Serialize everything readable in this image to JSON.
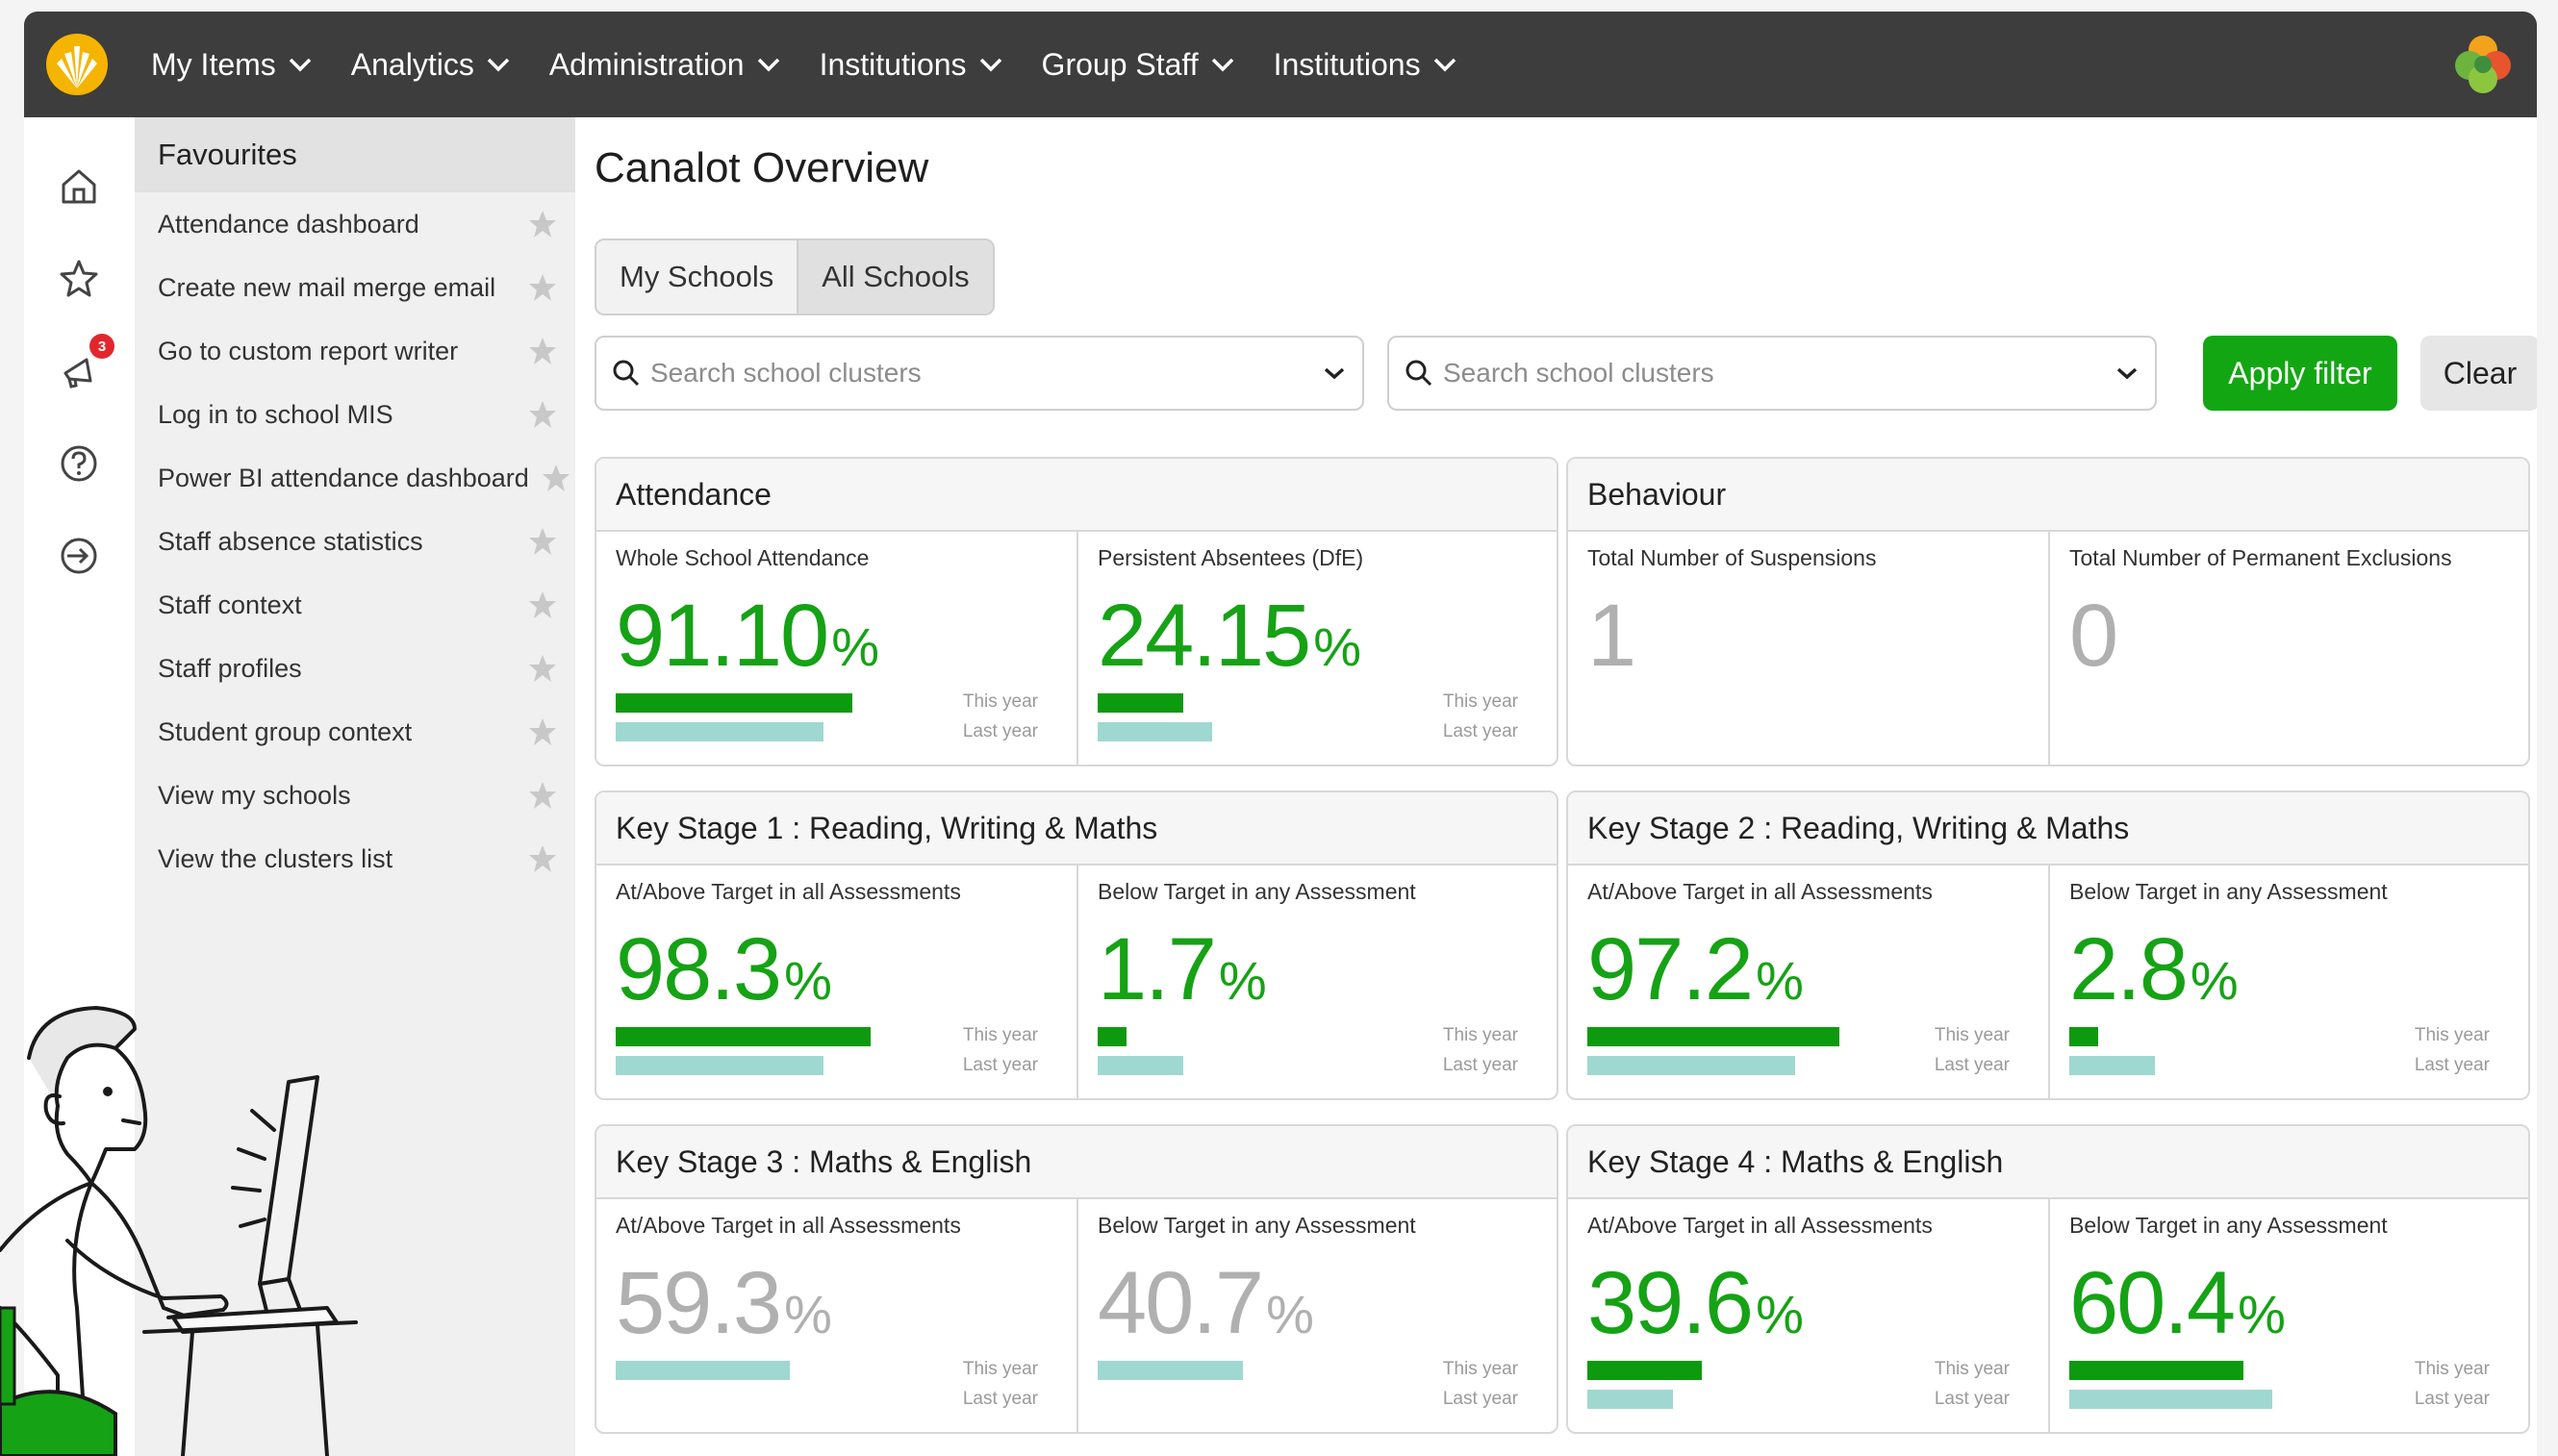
{
  "nav": {
    "items": [
      {
        "label": "My Items"
      },
      {
        "label": "Analytics"
      },
      {
        "label": "Administration"
      },
      {
        "label": "Institutions"
      },
      {
        "label": "Group Staff"
      },
      {
        "label": "Institutions"
      }
    ]
  },
  "rail": {
    "notification_count": "3"
  },
  "favourites": {
    "title": "Favourites",
    "items": [
      {
        "label": "Attendance dashboard"
      },
      {
        "label": "Create new mail merge email"
      },
      {
        "label": "Go to custom report writer"
      },
      {
        "label": "Log in to school MIS"
      },
      {
        "label": "Power BI attendance dashboard"
      },
      {
        "label": "Staff absence statistics"
      },
      {
        "label": "Staff context"
      },
      {
        "label": "Staff profiles"
      },
      {
        "label": "Student group context"
      },
      {
        "label": "View my schools"
      },
      {
        "label": "View the clusters list"
      }
    ]
  },
  "main": {
    "title": "Canalot Overview",
    "toggle": {
      "my_schools": "My Schools",
      "all_schools": "All Schools",
      "selected": "All Schools"
    },
    "search1": {
      "placeholder": "Search school clusters"
    },
    "search2": {
      "placeholder": "Search school clusters"
    },
    "apply_label": "Apply filter",
    "clear_label": "Clear"
  },
  "legend": {
    "this_year": "This year",
    "last_year": "Last year"
  },
  "cards": {
    "attendance": {
      "title": "Attendance",
      "m1": {
        "label": "Whole School Attendance",
        "value": "91.10",
        "unit": "%",
        "this_year": 0.911,
        "last_year": 0.8
      },
      "m2": {
        "label": "Persistent Absentees (DfE)",
        "value": "24.15",
        "unit": "%",
        "this_year": 0.33,
        "last_year": 0.44
      }
    },
    "behaviour": {
      "title": "Behaviour",
      "m1": {
        "label": "Total Number of Suspensions",
        "value": "1"
      },
      "m2": {
        "label": "Total Number of Permanent Exclusions",
        "value": "0"
      }
    },
    "ks1": {
      "title": "Key Stage 1 : Reading, Writing & Maths",
      "m1": {
        "label": "At/Above Target in all Assessments",
        "value": "98.3",
        "unit": "%",
        "this_year": 0.983,
        "last_year": 0.8
      },
      "m2": {
        "label": "Below Target in any Assessment",
        "value": "1.7",
        "unit": "%",
        "this_year": 0.11,
        "last_year": 0.33
      }
    },
    "ks2": {
      "title": "Key Stage 2 : Reading, Writing & Maths",
      "m1": {
        "label": "At/Above Target in all Assessments",
        "value": "97.2",
        "unit": "%",
        "this_year": 0.972,
        "last_year": 0.8
      },
      "m2": {
        "label": "Below Target in any Assessment",
        "value": "2.8",
        "unit": "%",
        "this_year": 0.11,
        "last_year": 0.33
      }
    },
    "ks3": {
      "title": "Key Stage 3 : Maths & English",
      "m1": {
        "label": "At/Above Target in all Assessments",
        "value": "59.3",
        "unit": "%",
        "this_year": null,
        "last_year": 0.67
      },
      "m2": {
        "label": "Below Target in any Assessment",
        "value": "40.7",
        "unit": "%",
        "this_year": null,
        "last_year": 0.56
      }
    },
    "ks4": {
      "title": "Key Stage 4 : Maths & English",
      "m1": {
        "label": "At/Above Target in all Assessments",
        "value": "39.6",
        "unit": "%",
        "this_year": 0.44,
        "last_year": 0.33
      },
      "m2": {
        "label": "Below Target in any Assessment",
        "value": "60.4",
        "unit": "%",
        "this_year": 0.67,
        "last_year": 0.78
      }
    }
  },
  "colors": {
    "accent_green": "#15a215",
    "bar_this_year": "#0e9a0e",
    "bar_last_year": "#9fd8d1",
    "topbar": "#3d3d3d",
    "badge": "#e3262d"
  }
}
